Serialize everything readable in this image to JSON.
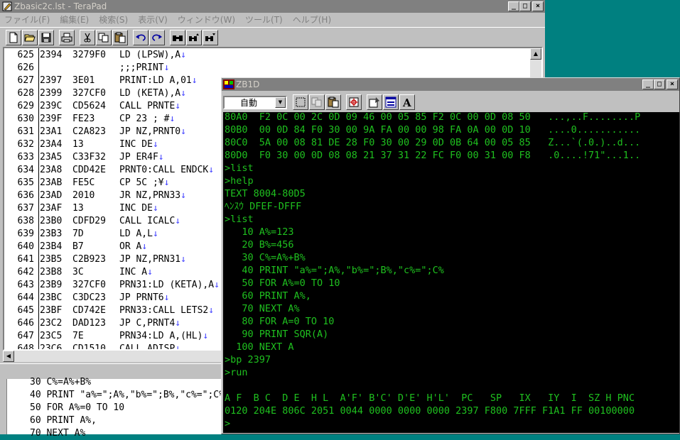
{
  "terapad": {
    "title": "Zbasic2c.lst - TeraPad",
    "menu": [
      "ファイル(F)",
      "編集(E)",
      "検索(S)",
      "表示(V)",
      "ウィンドウ(W)",
      "ツール(T)",
      "ヘルプ(H)"
    ],
    "toolbar_icons": [
      "new-file-icon",
      "open-folder-icon",
      "save-icon",
      "print-icon",
      "cut-icon",
      "copy-icon",
      "paste-icon",
      "undo-icon",
      "redo-icon",
      "find-icon",
      "find-prev-icon",
      "find-next-icon"
    ],
    "lines": [
      {
        "n": "625",
        "addr": "2394",
        "code": "3279F0",
        "text": "LD (LPSW),A↓"
      },
      {
        "n": "626",
        "addr": "",
        "code": "",
        "text": ";;;PRINT↓"
      },
      {
        "n": "627",
        "addr": "2397",
        "code": "3E01",
        "text": "PRINT:LD A,01↓"
      },
      {
        "n": "628",
        "addr": "2399",
        "code": "327CF0",
        "text": "LD (KETA),A↓"
      },
      {
        "n": "629",
        "addr": "239C",
        "code": "CD5624",
        "text": "CALL PRNTE↓"
      },
      {
        "n": "630",
        "addr": "239F",
        "code": "FE23",
        "text": "CP 23 ; #↓"
      },
      {
        "n": "631",
        "addr": "23A1",
        "code": "C2A823",
        "text": "JP NZ,PRNT0↓"
      },
      {
        "n": "632",
        "addr": "23A4",
        "code": "13",
        "text": "INC DE↓"
      },
      {
        "n": "633",
        "addr": "23A5",
        "code": "C33F32",
        "text": "JP ER4F↓"
      },
      {
        "n": "634",
        "addr": "23A8",
        "code": "CDD42E",
        "text": "PRNT0:CALL ENDCK↓"
      },
      {
        "n": "635",
        "addr": "23AB",
        "code": "FE5C",
        "text": "CP 5C ;¥↓"
      },
      {
        "n": "636",
        "addr": "23AD",
        "code": "2010",
        "text": "JR NZ,PRN33↓"
      },
      {
        "n": "637",
        "addr": "23AF",
        "code": "13",
        "text": "INC DE↓"
      },
      {
        "n": "638",
        "addr": "23B0",
        "code": "CDFD29",
        "text": "CALL ICALC↓"
      },
      {
        "n": "639",
        "addr": "23B3",
        "code": "7D",
        "text": "LD A,L↓"
      },
      {
        "n": "640",
        "addr": "23B4",
        "code": "B7",
        "text": "OR A↓"
      },
      {
        "n": "641",
        "addr": "23B5",
        "code": "C2B923",
        "text": "JP NZ,PRN31↓"
      },
      {
        "n": "642",
        "addr": "23B8",
        "code": "3C",
        "text": "INC A↓"
      },
      {
        "n": "643",
        "addr": "23B9",
        "code": "327CF0",
        "text": "PRN31:LD (KETA),A↓"
      },
      {
        "n": "644",
        "addr": "23BC",
        "code": "C3DC23",
        "text": "JP PRNT6↓"
      },
      {
        "n": "645",
        "addr": "23BF",
        "code": "CD742E",
        "text": "PRN33:CALL LETS2↓"
      },
      {
        "n": "646",
        "addr": "23C2",
        "code": "DAD123",
        "text": "JP C,PRNT4↓"
      },
      {
        "n": "647",
        "addr": "23C5",
        "code": "7E",
        "text": "PRN34:LD A,(HL)↓"
      },
      {
        "n": "648",
        "addr": "23C6",
        "code": "CD1510",
        "text": "CALL ADISP↓"
      }
    ]
  },
  "background_window": {
    "lines": [
      "30 C%=A%+B%",
      "40 PRINT \"a%=\";A%,\"b%=\";B%,\"c%=\";C%",
      "50 FOR A%=0 TO 10",
      "60 PRINT A%,",
      "70 NEXT A%"
    ]
  },
  "zb1d": {
    "title": "ZB1D",
    "mode_select": "自動",
    "toolbar_icons": [
      "select-icon",
      "copy-icon",
      "paste-icon",
      "target-icon",
      "settings-icon",
      "window-icon",
      "font-icon"
    ],
    "console": [
      "80A0  F2 0C 00 2C 0D 09 46 00 05 85 F2 0C 00 0D 08 50   ...,..F........P",
      "80B0  00 0D 84 F0 30 00 9A FA 00 00 98 FA 0A 00 0D 10   ....0...........",
      "80C0  5A 00 08 81 DE 28 F0 30 00 29 0D 0B 64 00 05 85   Z...`(.0.)..d...",
      "80D0  F0 30 00 0D 08 08 21 37 31 22 FC F0 00 31 00 F8   .0....!71\"...1..",
      ">list",
      ">help",
      "TEXT 8004-80D5",
      "ﾍﾝｽｳ DFEF-DFFF",
      ">list",
      "   10 A%=123",
      "   20 B%=456",
      "   30 C%=A%+B%",
      "   40 PRINT \"a%=\";A%,\"b%=\";B%,\"c%=\";C%",
      "   50 FOR A%=0 TO 10",
      "   60 PRINT A%,",
      "   70 NEXT A%",
      "   80 FOR A=0 TO 10",
      "   90 PRINT SQR(A)",
      "  100 NEXT A",
      ">bp 2397",
      ">run",
      "",
      "A F  B C  D E  H L  A'F' B'C' D'E' H'L'  PC   SP   IX   IY  I  SZ H PNC",
      "0120 204E 806C 2051 0044 0000 0000 0000 2397 F800 7FFF F1A1 FF 00100000",
      ">"
    ]
  }
}
